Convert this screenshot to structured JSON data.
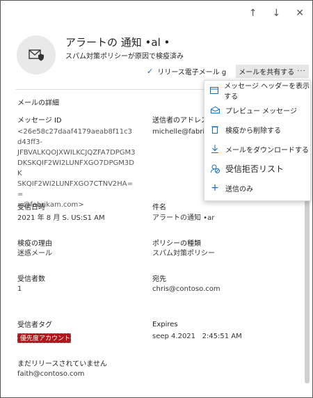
{
  "nav": {
    "up": "↑",
    "down": "↓",
    "close": "✕"
  },
  "header": {
    "title": "アラートの 通知 •al •",
    "subtitle": "スパム対策ポリシーが原因で検疫済み",
    "release_label": "リリース電子メール g",
    "share_label": "メールを共有する",
    "more": "···"
  },
  "section_title": "メールの詳細",
  "fields": {
    "message_id_label": "メッセージ ID",
    "message_id_value": "<26e58c27daaf4179aeab8f11c3d43ff3-\nJFBVALKQOJXWILKCJQZFA7DPGM3\nDKSKQIF2WI2LUNFXGO7DPGM3DK\nSKQIF2WI2LUNFXGO7CTNV2HA==\n=@fabrikam.com>",
    "sender_label": "送信者のアドレス",
    "sender_value": "michelle@fabrikam.com",
    "received_label": "受信日時",
    "received_value": "2021 年 8 月 S. US:S1 AM",
    "subject_label": "件名",
    "subject_value": "アラートの通知 •ar",
    "quarantine_reason_label": "検疫の理由",
    "quarantine_reason_value": "迷惑メール",
    "policy_type_label": "ポリシーの種類",
    "policy_type_value": "スパム対策ポリシー",
    "recipient_count_label": "受信者数",
    "recipient_count_value": "1",
    "to_label": "宛先",
    "to_value": "chris@contoso.com",
    "recipient_tag_label": "受信者タグ",
    "recipient_tag_value": "優先度アカウント",
    "expires_label": "Expires",
    "expires_value": "seep 4.2021   2:45:51 AM",
    "not_released_label": "まだリリースされていません",
    "not_released_value": "faith@contoso.com"
  },
  "menu": {
    "items": [
      {
        "label": "メッセージ ヘッダーを表示する",
        "icon": "header-icon"
      },
      {
        "label": "プレビュー メッセージ",
        "icon": "preview-icon"
      },
      {
        "label": "検疫から削除する",
        "icon": "trash-icon"
      },
      {
        "label": "メールをダウンロードする",
        "icon": "download-icon"
      },
      {
        "label": "受信拒否リスト",
        "icon": "block-user-icon"
      },
      {
        "label": "送信のみ",
        "icon": "plus-icon"
      }
    ]
  },
  "colors": {
    "accent": "#0f6cbd",
    "tag_bg": "#b0161a"
  }
}
